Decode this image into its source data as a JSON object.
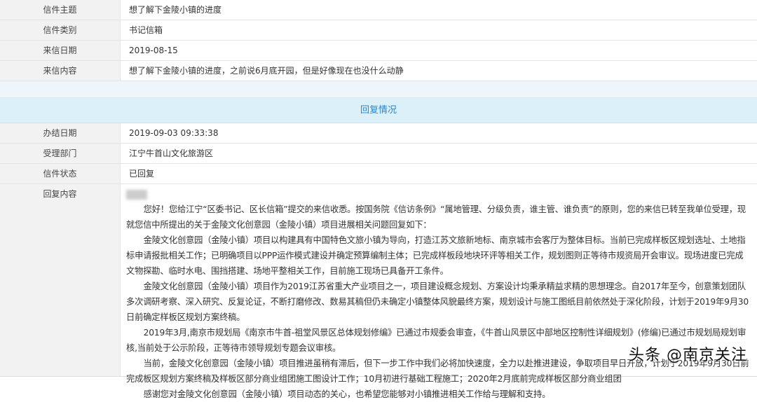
{
  "letter": [
    {
      "label": "信件主题",
      "value": "想了解下金陵小镇的进度"
    },
    {
      "label": "信件类别",
      "value": "书记信箱"
    },
    {
      "label": "来信日期",
      "value": "2019-08-15"
    },
    {
      "label": "来信内容",
      "value": "想了解下金陵小镇的进度，之前说6月底开园，但是好像现在也没什么动静"
    }
  ],
  "section_title": "回复情况",
  "reply": [
    {
      "label": "办结日期",
      "value": "2019-09-03 09:33:38"
    },
    {
      "label": "受理部门",
      "value": "江宁牛首山文化旅游区"
    },
    {
      "label": "信件状态",
      "value": "已回复"
    }
  ],
  "reply_content_label": "回复内容",
  "reply_paragraphs": [
    "您好！您给江宁“区委书记、区长信箱”提交的来信收悉。按国务院《信访条例》“属地管理、分级负责，谁主管、谁负责”的原则，您的来信已转至我单位受理，现就您信中所提出的关于金陵文化创意园（金陵小镇）项目进展相关问题回复如下：",
    "金陵文化创意园（金陵小镇）项目以构建具有中国特色文旅小镇为导向，打造江苏文旅新地标、南京城市会客厅为整体目标。当前已完成样板区规划选址、土地指标申请报批相关工作；已明确项目以PPP运作模式建设并确定预算编制主体；已完成样板段地块环评等相关工作，规划图则正等待市规资局开会审议。现场进度已完成文物探勘、临时水电、围挡搭建、场地平整相关工作，目前施工现场已具备开工条件。",
    "金陵文化创意园（金陵小镇）项目作为2019江苏省重大产业项目之一，项目建设概念规划、方案设计均秉承精益求精的思想理念。自2017年至今，创意策划团队多次调研考察、深入研究、反复论证，不断打磨修改、数易其稿但仍未确定小镇整体风貌最终方案，规划设计与施工图纸目前依然处于深化阶段，计划于2019年9月30日前确定样板区规划方案终稿。",
    "2019年3月,南京市规划局《南京市牛首-祖堂风景区总体规划修编》已通过市规委会审查，《牛首山风景区中部地区控制性详细规划》(修编)已通过市规划局规划审核,当前处于公示阶段，正等待市领导规划专题会议审核。",
    "当前，金陵文化创意园（金陵小镇）项目推进虽稍有滞后，但下一步工作中我们必将加快速度，全力以赴推进建设，争取项目早日开放，计划于2019年9月30日前完成板区规划方案终稿及样板区部分商业组团施工图设计工作；10月初进行基础工程施工；2020年2月底前完成样板区部分商业组团",
    "感谢您对金陵文化创意园（金陵小镇）项目动态的关心，也希望您能够对小镇推进相关工作给与理解和支持。"
  ],
  "watermark": "头条 @南京关注"
}
